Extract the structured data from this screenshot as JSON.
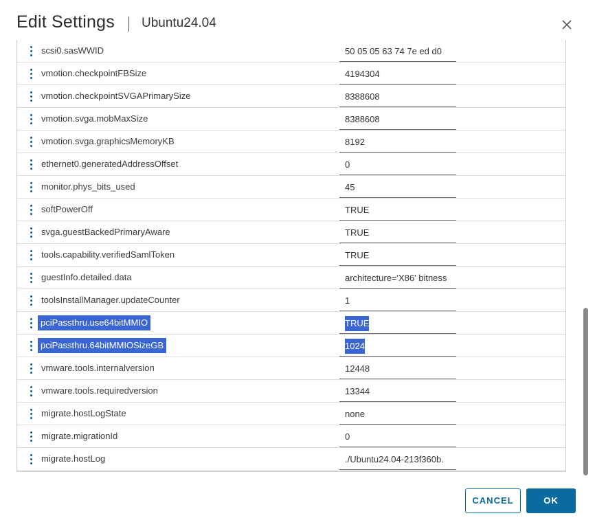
{
  "dialog": {
    "title": "Edit Settings",
    "subtitle": "Ubuntu24.04",
    "close_icon": "close-icon"
  },
  "table": {
    "rows": [
      {
        "name": "scsi0.sasWWID",
        "value": "50 05 05 63 74 7e ed d0",
        "selected": false
      },
      {
        "name": "vmotion.checkpointFBSize",
        "value": "4194304",
        "selected": false
      },
      {
        "name": "vmotion.checkpointSVGAPrimarySize",
        "value": "8388608",
        "selected": false
      },
      {
        "name": "vmotion.svga.mobMaxSize",
        "value": "8388608",
        "selected": false
      },
      {
        "name": "vmotion.svga.graphicsMemoryKB",
        "value": "8192",
        "selected": false
      },
      {
        "name": "ethernet0.generatedAddressOffset",
        "value": "0",
        "selected": false
      },
      {
        "name": "monitor.phys_bits_used",
        "value": "45",
        "selected": false
      },
      {
        "name": "softPowerOff",
        "value": "TRUE",
        "selected": false
      },
      {
        "name": "svga.guestBackedPrimaryAware",
        "value": "TRUE",
        "selected": false
      },
      {
        "name": "tools.capability.verifiedSamlToken",
        "value": "TRUE",
        "selected": false
      },
      {
        "name": "guestInfo.detailed.data",
        "value": "architecture='X86' bitness",
        "selected": false
      },
      {
        "name": "toolsInstallManager.updateCounter",
        "value": "1",
        "selected": false
      },
      {
        "name": "pciPassthru.use64bitMMIO",
        "value": "TRUE",
        "selected": true
      },
      {
        "name": "pciPassthru.64bitMMIOSizeGB",
        "value": "1024",
        "selected": true
      },
      {
        "name": "vmware.tools.internalversion",
        "value": "12448",
        "selected": false
      },
      {
        "name": "vmware.tools.requiredversion",
        "value": "13344",
        "selected": false
      },
      {
        "name": "migrate.hostLogState",
        "value": "none",
        "selected": false
      },
      {
        "name": "migrate.migrationId",
        "value": "0",
        "selected": false
      },
      {
        "name": "migrate.hostLog",
        "value": "./Ubuntu24.04-213f360b.",
        "selected": false
      }
    ]
  },
  "footer": {
    "cancel_label": "CANCEL",
    "ok_label": "OK"
  },
  "colors": {
    "accent": "#0b6a9e",
    "selection": "#3a66d4"
  }
}
